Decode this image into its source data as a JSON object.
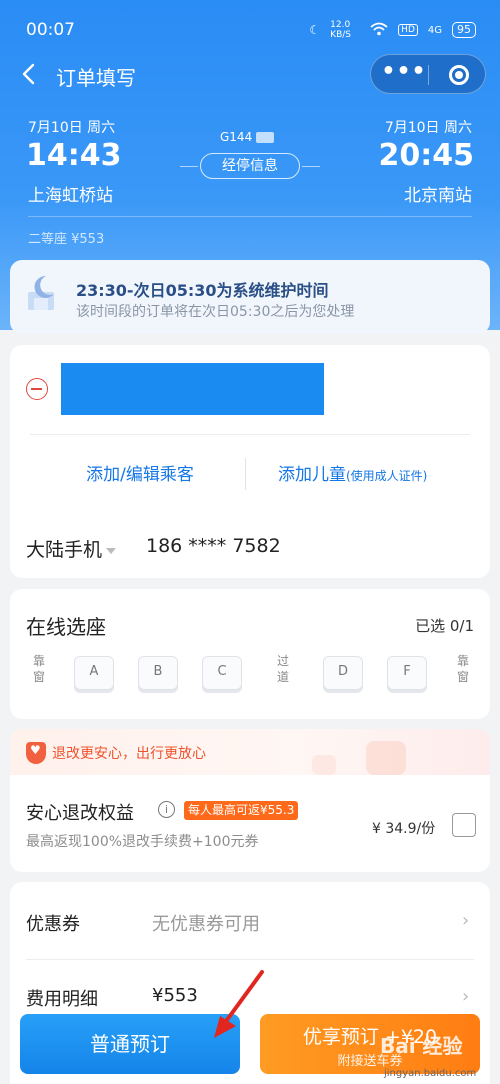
{
  "status_bar": {
    "time": "00:07",
    "net_speed": "12.0 KB/S",
    "hd": "HD",
    "signal": "4G",
    "battery": "95"
  },
  "nav": {
    "title": "订单填写",
    "more": "•••"
  },
  "trip": {
    "departure": {
      "date": "7月10日 周六",
      "time": "14:43",
      "station": "上海虹桥站"
    },
    "arrival": {
      "date": "7月10日 周六",
      "time": "20:45",
      "station": "北京南站"
    },
    "train_no": "G144",
    "stops_button": "经停信息",
    "seat_price": "二等座 ¥553"
  },
  "notice": {
    "title": "23:30-次日05:30为系统维护时间",
    "subtitle": "该时间段的订单将在次日05:30之后为您处理"
  },
  "passengers": {
    "add_passenger": "添加/编辑乘客",
    "add_child": "添加儿童",
    "add_child_note": "(使用成人证件)",
    "phone_label": "大陆手机",
    "phone_value": "186 **** 7582"
  },
  "seat_select": {
    "title": "在线选座",
    "selected": "已选 0/1",
    "window_left": "靠窗",
    "aisle": "过道",
    "window_right": "靠窗",
    "seats": [
      "A",
      "B",
      "C",
      "D",
      "F"
    ]
  },
  "insurance": {
    "banner": "退改更安心，出行更放心",
    "title": "安心退改权益",
    "promo": "每人最高可返¥55.3",
    "description": "最高返现100%退改手续费+100元券",
    "price": "¥ 34.9/份"
  },
  "fees": {
    "coupon_label": "优惠券",
    "coupon_value": "无优惠券可用",
    "detail_label": "费用明细",
    "detail_value": "¥553"
  },
  "actions": {
    "normal_booking": "普通预订",
    "premium_booking": "优享预订 +¥20",
    "premium_sub": "附接送车券"
  },
  "watermark": {
    "brand": "Bai 经验",
    "url": "jingyan.baidu.com"
  },
  "colors": {
    "primary": "#1677e6",
    "header": "#2a8cf5",
    "accent_orange": "#ff7d12",
    "danger": "#e0483d"
  }
}
